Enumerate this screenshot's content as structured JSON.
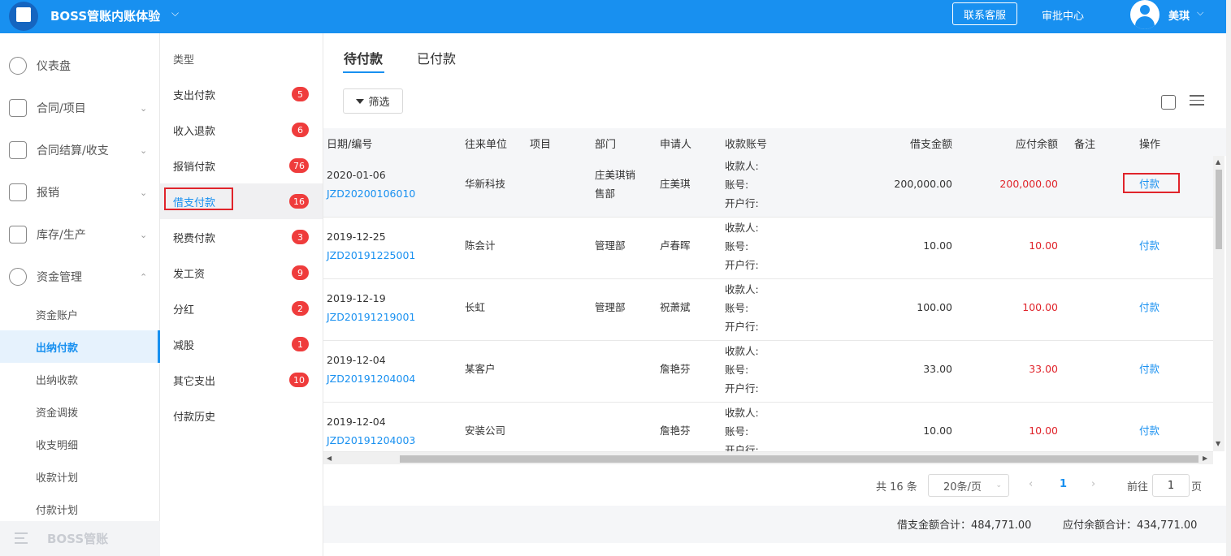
{
  "header": {
    "app_title": "BOSS管账内账体验",
    "service_btn": "联系客服",
    "approval": "审批中心",
    "user_name": "美琪"
  },
  "sidebar": {
    "items": [
      {
        "label": "仪表盘",
        "icon": "dashboard-icon"
      },
      {
        "label": "合同/项目",
        "icon": "folder-icon"
      },
      {
        "label": "合同结算/收支",
        "icon": "settlement-icon"
      },
      {
        "label": "报销",
        "icon": "reimburse-icon"
      },
      {
        "label": "库存/生产",
        "icon": "box-icon"
      },
      {
        "label": "资金管理",
        "icon": "fund-icon"
      }
    ],
    "sub_items": [
      "资金账户",
      "出纳付款",
      "出纳收款",
      "资金调拨",
      "收支明细",
      "收款计划",
      "付款计划"
    ],
    "footer": "BOSS管账"
  },
  "types": {
    "header": "类型",
    "items": [
      {
        "label": "支出付款",
        "count": "5"
      },
      {
        "label": "收入退款",
        "count": "6"
      },
      {
        "label": "报销付款",
        "count": "76"
      },
      {
        "label": "借支付款",
        "count": "16"
      },
      {
        "label": "税费付款",
        "count": "3"
      },
      {
        "label": "发工资",
        "count": "9"
      },
      {
        "label": "分红",
        "count": "2"
      },
      {
        "label": "减股",
        "count": "1"
      },
      {
        "label": "其它支出",
        "count": "10"
      },
      {
        "label": "付款历史",
        "count": ""
      }
    ]
  },
  "tabs": [
    "待付款",
    "已付款"
  ],
  "filter_label": "筛选",
  "table": {
    "headers": [
      "日期/编号",
      "往来单位",
      "项目",
      "部门",
      "申请人",
      "收款账号",
      "借支金额",
      "应付余额",
      "备注",
      "操作"
    ],
    "account_labels": [
      "收款人:",
      "账号:",
      "开户行:"
    ],
    "rows": [
      {
        "date": "2020-01-06",
        "code": "JZD20200106010",
        "unit": "华新科技",
        "dept": "庄美琪销",
        "dept2": "售部",
        "applicant": "庄美琪",
        "amount": "200,000.00",
        "balance": "200,000.00",
        "action": "付款"
      },
      {
        "date": "2019-12-25",
        "code": "JZD20191225001",
        "unit": "陈会计",
        "dept": "管理部",
        "dept2": "",
        "applicant": "卢春晖",
        "amount": "10.00",
        "balance": "10.00",
        "action": "付款"
      },
      {
        "date": "2019-12-19",
        "code": "JZD20191219001",
        "unit": "长虹",
        "dept": "管理部",
        "dept2": "",
        "applicant": "祝萧斌",
        "amount": "100.00",
        "balance": "100.00",
        "action": "付款"
      },
      {
        "date": "2019-12-04",
        "code": "JZD20191204004",
        "unit": "某客户",
        "dept": "",
        "dept2": "",
        "applicant": "詹艳芬",
        "amount": "33.00",
        "balance": "33.00",
        "action": "付款"
      },
      {
        "date": "2019-12-04",
        "code": "JZD20191204003",
        "unit": "安装公司",
        "dept": "",
        "dept2": "",
        "applicant": "詹艳芬",
        "amount": "10.00",
        "balance": "10.00",
        "action": "付款"
      }
    ]
  },
  "pager": {
    "total": "共 16 条",
    "page_size": "20条/页",
    "current": "1",
    "goto_label": "前往",
    "goto_value": "1",
    "page_unit": "页"
  },
  "totals": {
    "borrow": "借支金额合计：484,771.00",
    "balance": "应付余额合计：434,771.00"
  }
}
